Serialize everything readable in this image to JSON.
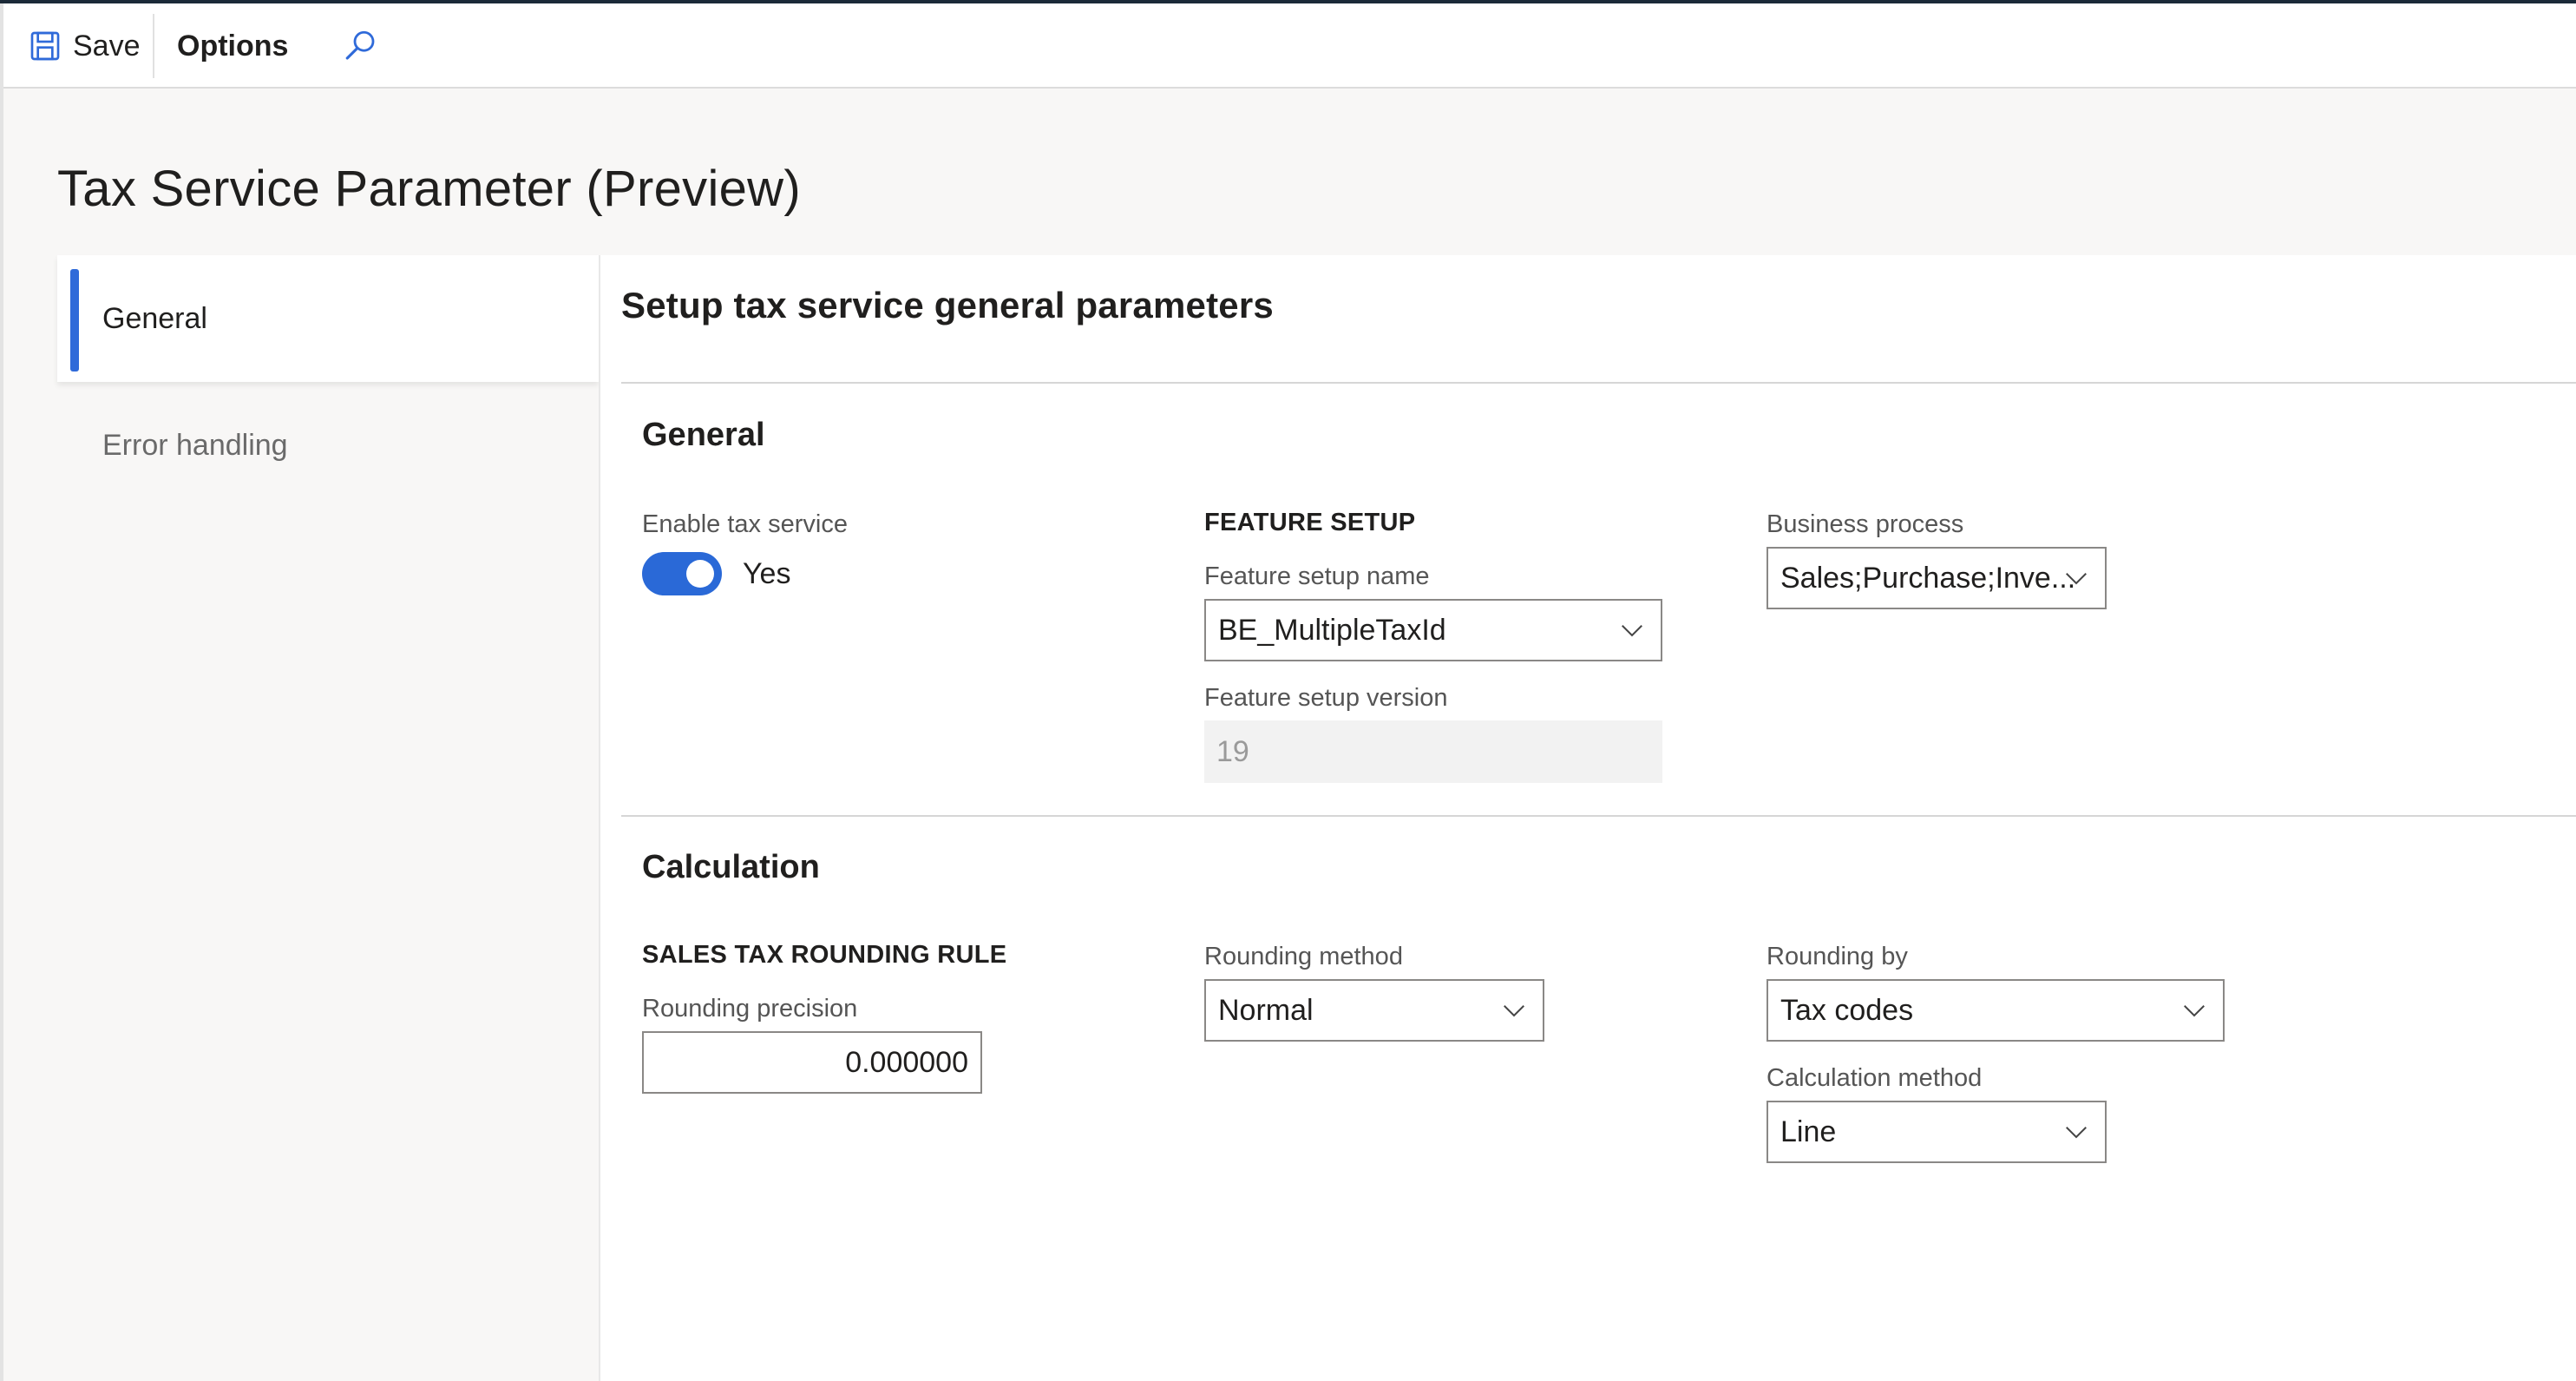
{
  "toolbar": {
    "save_label": "Save",
    "options_label": "Options",
    "search_icon": "search-icon",
    "save_icon": "floppy-disk-icon"
  },
  "page": {
    "title": "Tax Service Parameter (Preview)"
  },
  "nav": {
    "items": [
      {
        "label": "General",
        "active": true
      },
      {
        "label": "Error handling",
        "active": false
      }
    ]
  },
  "content": {
    "subtitle": "Setup tax service general parameters",
    "general": {
      "title": "General",
      "enable_tax_service": {
        "label": "Enable tax service",
        "value": "Yes",
        "on": true
      },
      "feature_setup": {
        "group_label": "FEATURE SETUP",
        "name_label": "Feature setup name",
        "name_value": "BE_MultipleTaxId",
        "version_label": "Feature setup version",
        "version_value": "19"
      },
      "business_process": {
        "label": "Business process",
        "value": "Sales;Purchase;Inve..."
      }
    },
    "calculation": {
      "title": "Calculation",
      "rounding_rule_group": "SALES TAX ROUNDING RULE",
      "rounding_precision": {
        "label": "Rounding precision",
        "value": "0.000000"
      },
      "rounding_method": {
        "label": "Rounding method",
        "value": "Normal"
      },
      "rounding_by": {
        "label": "Rounding by",
        "value": "Tax codes"
      },
      "calculation_method": {
        "label": "Calculation method",
        "value": "Line"
      }
    }
  },
  "colors": {
    "accent": "#2f6ad9",
    "toggle_on": "#2a69d7",
    "top_bar": "#1b2a38"
  }
}
